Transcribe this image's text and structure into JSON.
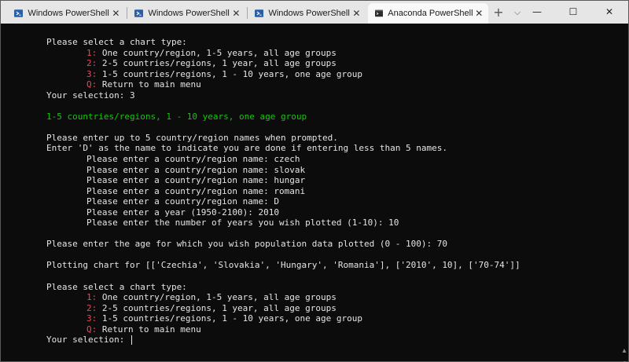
{
  "tabs": [
    {
      "title": "Windows PowerShell",
      "active": false
    },
    {
      "title": "Windows PowerShell",
      "active": false
    },
    {
      "title": "Windows PowerShell",
      "active": false
    },
    {
      "title": "Anaconda PowerShell",
      "active": true
    }
  ],
  "titlebar": {
    "new_tab": "+",
    "dropdown": "⌵",
    "minimize": "—",
    "maximize": "☐",
    "close": "✕",
    "tab_close": "✕"
  },
  "terminal": {
    "block1": {
      "prompt": "Please select a chart type:",
      "opt1_key": "1:",
      "opt1_text": " One country/region, 1-5 years, all age groups",
      "opt2_key": "2:",
      "opt2_text": " 2-5 countries/regions, 1 year, all age groups",
      "opt3_key": "3:",
      "opt3_text": " 1-5 countries/regions, 1 - 10 years, one age group",
      "optq_key": "Q:",
      "optq_text": " Return to main menu",
      "selection": "Your selection: 3"
    },
    "heading": "1-5 countries/regions, 1 - 10 years, one age group",
    "instr1": "Please enter up to 5 country/region names when prompted.",
    "instr2": "Enter 'D' as the name to indicate you are done if entering less than 5 names.",
    "entries": [
      "Please enter a country/region name: czech",
      "Please enter a country/region name: slovak",
      "Please enter a country/region name: hungar",
      "Please enter a country/region name: romani",
      "Please enter a country/region name: D",
      "Please enter a year (1950-2100): 2010",
      "Please enter the number of years you wish plotted (1-10): 10"
    ],
    "age_prompt": "Please enter the age for which you wish population data plotted (0 - 100): 70",
    "plotting": "Plotting chart for [['Czechia', 'Slovakia', 'Hungary', 'Romania'], ['2010', 10], ['70-74']]",
    "block2": {
      "prompt": "Please select a chart type:",
      "opt1_key": "1:",
      "opt1_text": " One country/region, 1-5 years, all age groups",
      "opt2_key": "2:",
      "opt2_text": " 2-5 countries/regions, 1 year, all age groups",
      "opt3_key": "3:",
      "opt3_text": " 1-5 countries/regions, 1 - 10 years, one age group",
      "optq_key": "Q:",
      "optq_text": " Return to main menu",
      "selection": "Your selection: "
    }
  }
}
